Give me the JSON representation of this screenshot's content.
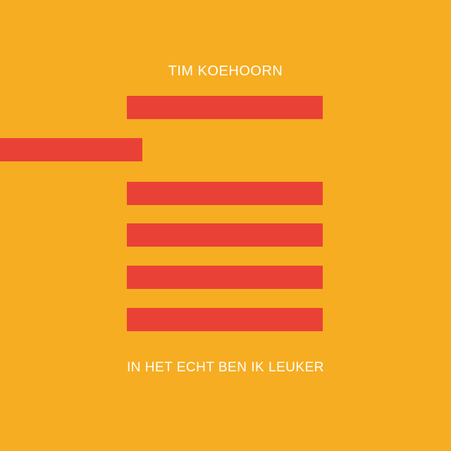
{
  "cover": {
    "artist": "TIM KOEHOORN",
    "album_title": "IN HET ECHT BEN IK LEUKER",
    "bar_count": 6
  },
  "colors": {
    "background": "#F6AD22",
    "bar": "#EA4137",
    "text": "#FFFFFF"
  }
}
